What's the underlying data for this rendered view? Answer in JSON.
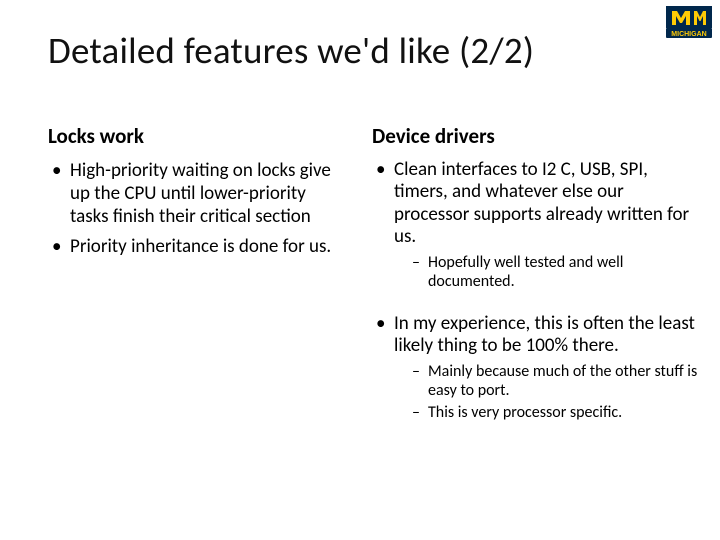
{
  "title": "Detailed features we'd like (2/2)",
  "logo": {
    "name": "michigan-logo"
  },
  "left": {
    "heading": "Locks work",
    "items": [
      "High-priority waiting on locks give up the CPU until lower-priority tasks finish their critical section",
      "Priority inheritance is done for us."
    ]
  },
  "right": {
    "heading": "Device drivers",
    "items": [
      {
        "text": "Clean interfaces to I2 C, USB, SPI, timers, and whatever else our processor supports already written for us.",
        "sub": [
          "Hopefully well tested and well documented."
        ]
      },
      {
        "text": "In my experience, this is often the least likely thing to be 100% there.",
        "sub": [
          "Mainly because much of the other stuff is easy to port.",
          "This is very processor specific."
        ]
      }
    ]
  }
}
